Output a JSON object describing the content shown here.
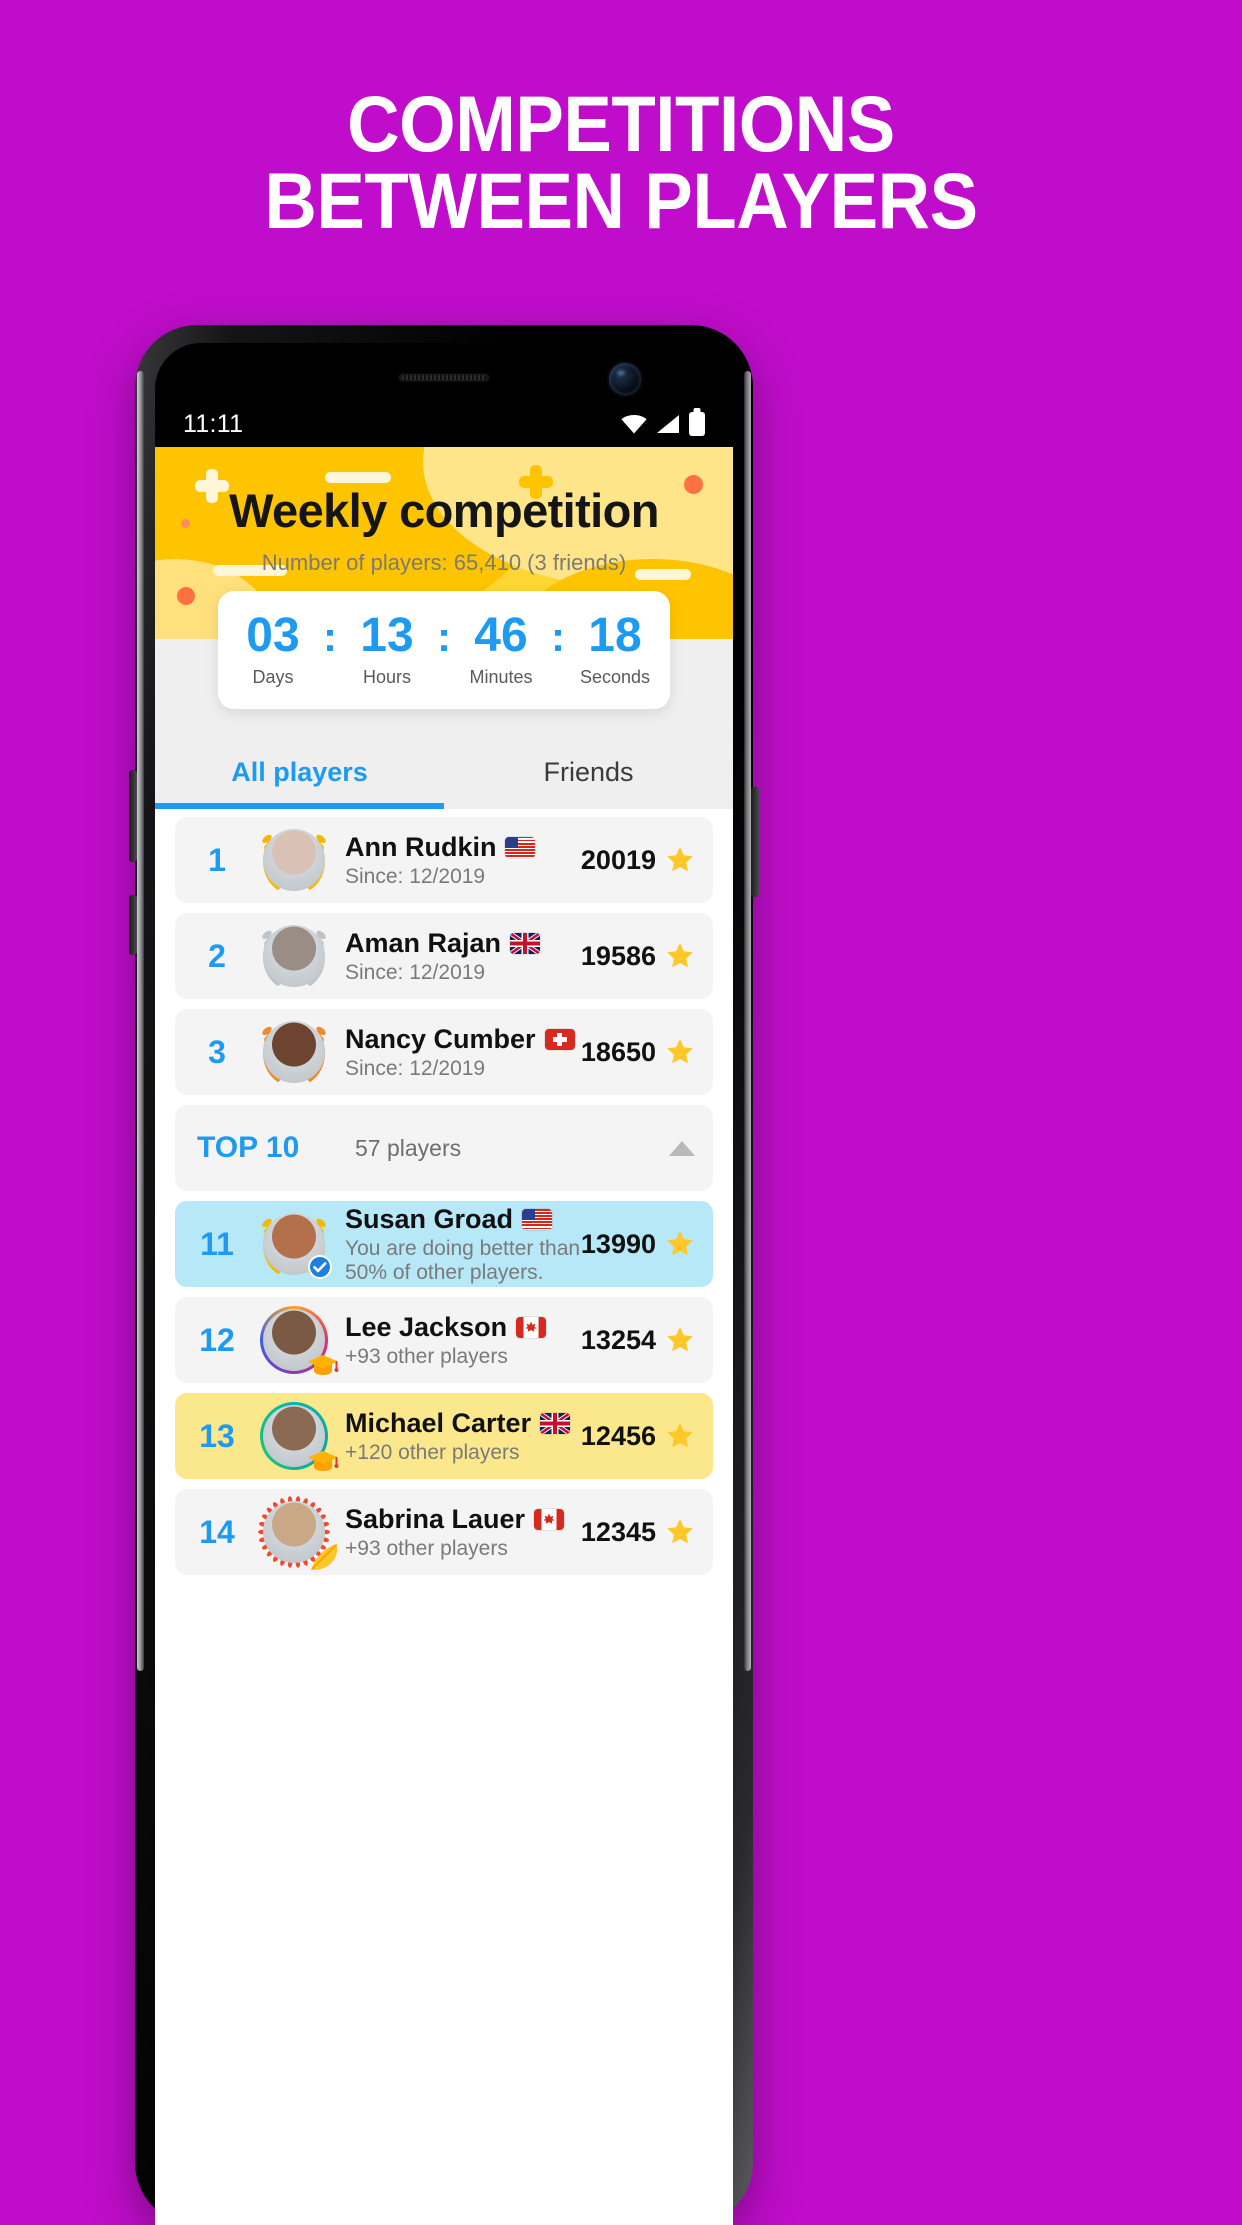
{
  "promo": {
    "line1": "COMPETITIONS",
    "line2": "BETWEEN PLAYERS"
  },
  "status_bar": {
    "time": "11:11",
    "icons": [
      "wifi-icon",
      "cellular-signal-icon",
      "battery-icon"
    ]
  },
  "hero": {
    "title": "Weekly competition",
    "subtitle": "Number of players: 65,410 (3 friends)"
  },
  "countdown": {
    "separator": ":",
    "units": [
      {
        "value": "03",
        "label": "Days"
      },
      {
        "value": "13",
        "label": "Hours"
      },
      {
        "value": "46",
        "label": "Minutes"
      },
      {
        "value": "18",
        "label": "Seconds"
      }
    ]
  },
  "tabs": [
    {
      "label": "All players",
      "active": true
    },
    {
      "label": "Friends",
      "active": false
    }
  ],
  "divider": {
    "label": "TOP 10",
    "count": "57 players",
    "caret": "chevron-up-icon"
  },
  "rows": [
    {
      "rank": "1",
      "name": "Ann Rudkin",
      "sub": "Since: 12/2019",
      "score": "20019",
      "flag": "us",
      "wreath": "gold",
      "highlight": "none",
      "avatar_tone": "#d9c2b5"
    },
    {
      "rank": "2",
      "name": "Aman Rajan",
      "sub": "Since: 12/2019",
      "score": "19586",
      "flag": "gb",
      "wreath": "silver",
      "highlight": "none",
      "avatar_tone": "#9a8d86"
    },
    {
      "rank": "3",
      "name": "Nancy Cumber",
      "sub": "Since: 12/2019",
      "score": "18650",
      "flag": "ch",
      "wreath": "bronze",
      "highlight": "none",
      "avatar_tone": "#6d4430"
    },
    {
      "rank": "11",
      "name": "Susan Groad",
      "sub": "You are doing better than 50% of other players.",
      "score": "13990",
      "flag": "us",
      "wreath": "gold",
      "highlight": "blue",
      "badge": "verified-check-icon",
      "avatar_tone": "#b4704a"
    },
    {
      "rank": "12",
      "name": "Lee Jackson",
      "sub": "+93 other players",
      "score": "13254",
      "flag": "ca",
      "wreath": "none",
      "ring": "gradient",
      "highlight": "none",
      "badge": "graduation-cap-icon",
      "avatar_tone": "#7a5a45"
    },
    {
      "rank": "13",
      "name": "Michael Carter",
      "sub": "+120 other players",
      "score": "12456",
      "flag": "gb",
      "wreath": "none",
      "ring": "teal",
      "highlight": "yellow",
      "badge": "graduation-cap-icon",
      "avatar_tone": "#8a6a52"
    },
    {
      "rank": "14",
      "name": "Sabrina Lauer",
      "sub": "+93 other players",
      "score": "12345",
      "flag": "ca",
      "wreath": "red-rays",
      "highlight": "none",
      "badge": "feather-icon",
      "avatar_tone": "#c9a887"
    }
  ],
  "colors": {
    "background": "#C00DCB",
    "accent_blue": "#1E9BF0",
    "hero_yellow": "#FFD633",
    "star_gold": "#FFC727",
    "row_bg": "#F4F4F4",
    "highlight_blue": "#B6E8F7",
    "highlight_yellow": "#FCE88C"
  }
}
